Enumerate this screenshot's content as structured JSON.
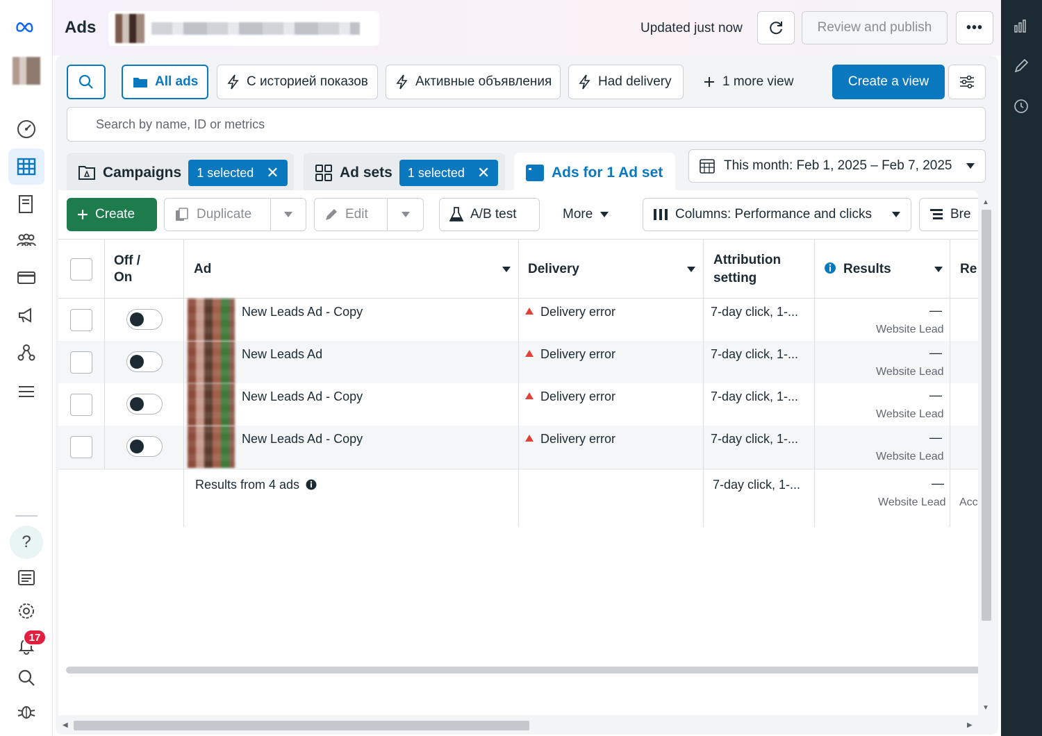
{
  "header": {
    "title": "Ads",
    "status": "Updated just now",
    "review_label": "Review and publish",
    "more_label": "•••"
  },
  "views": {
    "all_ads": "All ads",
    "view1": "С историей показов",
    "view2": "Активные объявления",
    "view3": "Had delivery",
    "more_views": "1 more view",
    "create_view": "Create a view"
  },
  "search": {
    "placeholder": "Search by name, ID or metrics"
  },
  "levels": {
    "campaigns": {
      "label": "Campaigns",
      "selected": "1 selected"
    },
    "adsets": {
      "label": "Ad sets",
      "selected": "1 selected"
    },
    "ads": {
      "label": "Ads for 1 Ad set"
    }
  },
  "date_range": "This month: Feb 1, 2025 – Feb 7, 2025",
  "toolbar": {
    "create": "Create",
    "duplicate": "Duplicate",
    "edit": "Edit",
    "ab_test": "A/B test",
    "more": "More",
    "columns": "Columns: Performance and clicks",
    "breakdown": "Bre"
  },
  "table": {
    "headers": {
      "off_on": "Off / On",
      "ad": "Ad",
      "delivery": "Delivery",
      "attribution": "Attribution setting",
      "results": "Results",
      "reach": "Re"
    },
    "rows": [
      {
        "ad": "New Leads Ad - Copy",
        "delivery": "Delivery error",
        "attribution": "7-day click, 1-...",
        "results": "—",
        "results_sub": "Website Lead"
      },
      {
        "ad": "New Leads Ad",
        "delivery": "Delivery error",
        "attribution": "7-day click, 1-...",
        "results": "—",
        "results_sub": "Website Lead"
      },
      {
        "ad": "New Leads Ad - Copy",
        "delivery": "Delivery error",
        "attribution": "7-day click, 1-...",
        "results": "—",
        "results_sub": "Website Lead"
      },
      {
        "ad": "New Leads Ad - Copy",
        "delivery": "Delivery error",
        "attribution": "7-day click, 1-...",
        "results": "—",
        "results_sub": "Website Lead"
      }
    ],
    "summary": {
      "label": "Results from 4 ads",
      "attribution": "7-day click, 1-...",
      "results": "—",
      "results_sub": "Website Lead",
      "reach_sub": "Acc"
    }
  },
  "nav": {
    "notifications_count": "17",
    "help": "?"
  },
  "colors": {
    "accent": "#0a78be",
    "create_green": "#1d7b4c",
    "error_red": "#e0423a",
    "rail_dark": "#1c2b33"
  }
}
